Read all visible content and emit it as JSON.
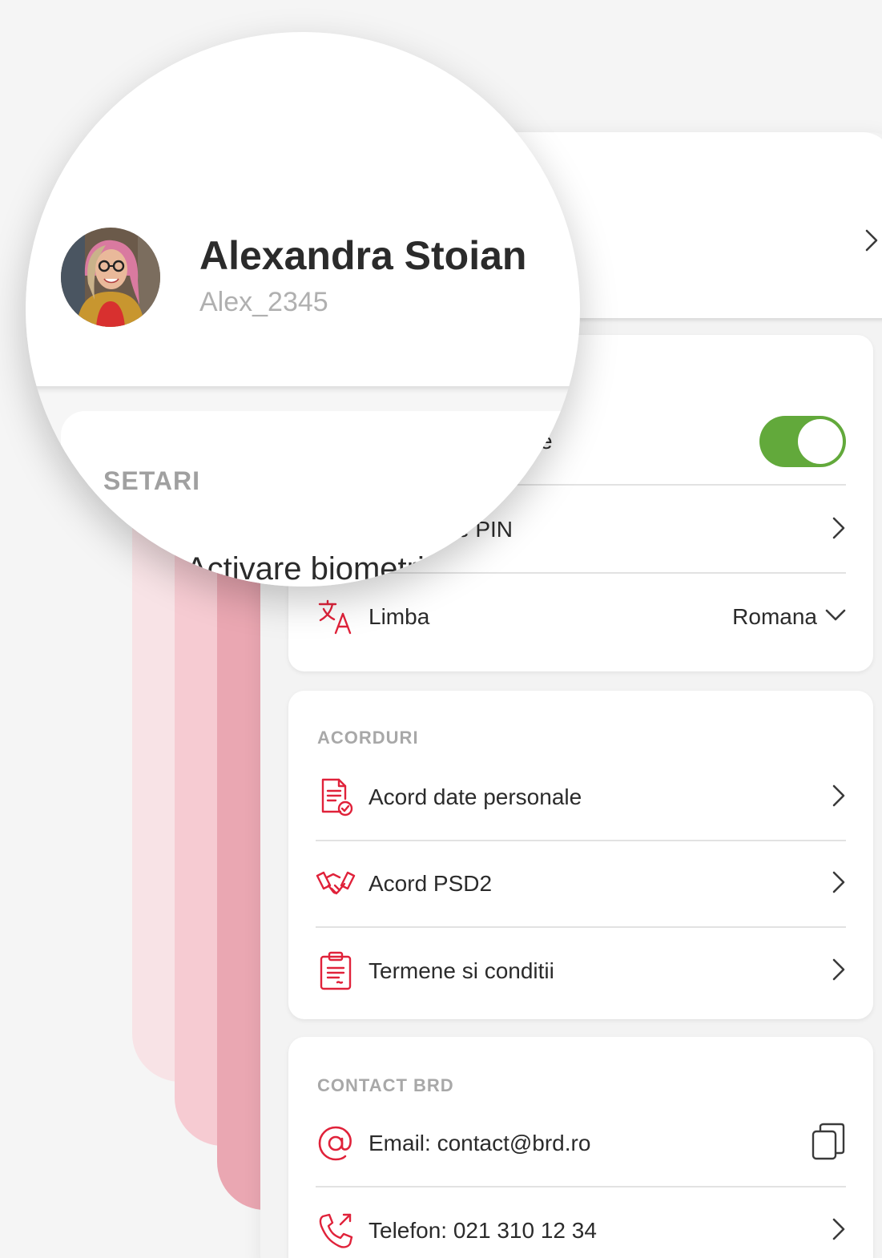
{
  "profile": {
    "name": "Alexandra Stoian",
    "name_partial": "ian",
    "username": "Alex_2345"
  },
  "settings": {
    "title": "SETARI",
    "biometric": {
      "label": "Activare biometri",
      "label_partial": "e",
      "enabled": true
    },
    "pin": {
      "label_partial": "e PIN"
    },
    "language": {
      "label": "Limba",
      "value": "Romana",
      "icon": "translate-icon"
    }
  },
  "agreements": {
    "title": "ACORDURI",
    "items": [
      {
        "label": "Acord date personale",
        "icon": "document-check-icon"
      },
      {
        "label": "Acord PSD2",
        "icon": "handshake-icon"
      },
      {
        "label": "Termene si conditii",
        "icon": "clipboard-icon"
      }
    ]
  },
  "contact": {
    "title": "CONTACT BRD",
    "email": {
      "label": "Email: contact@brd.ro",
      "icon": "at-icon",
      "action_icon": "copy-icon"
    },
    "phone": {
      "label": "Telefon: 021 310 12 34",
      "icon": "phone-icon"
    }
  },
  "colors": {
    "accent_red": "#e0223a",
    "toggle_on": "#62a93b",
    "stripe_light": "#f8e3e6",
    "stripe_mid": "#f6cbd2",
    "stripe_dark": "#eaa7b2"
  }
}
